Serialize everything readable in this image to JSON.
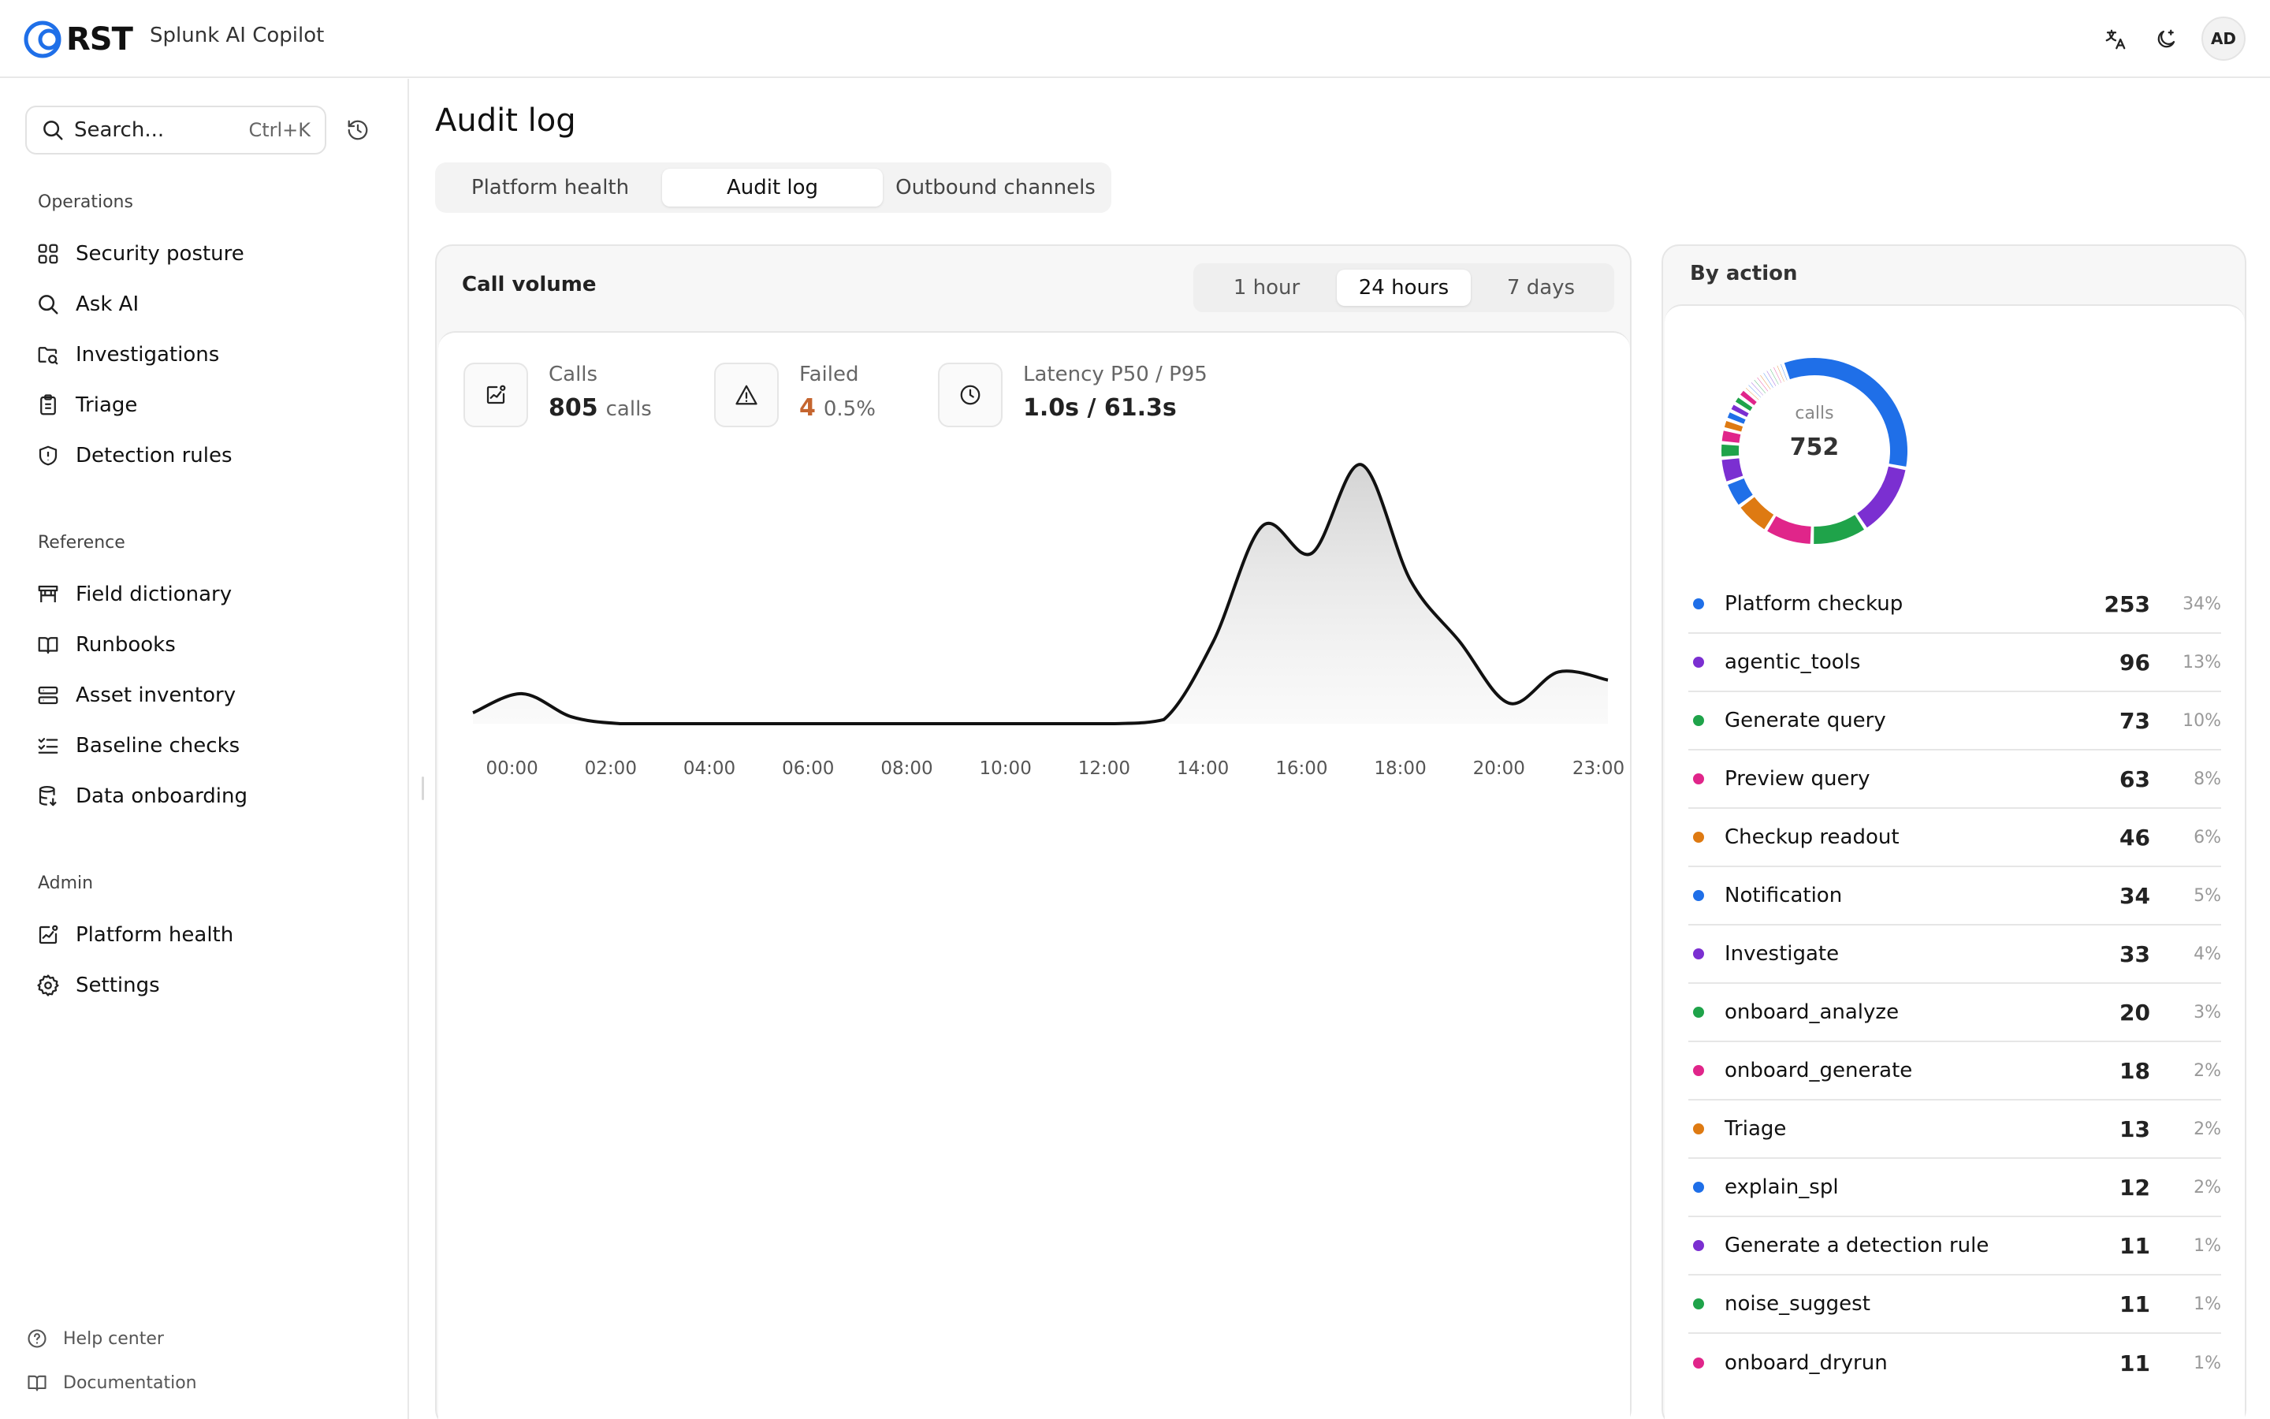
{
  "header": {
    "logo_text": "RST",
    "app_title": "Splunk AI Copilot",
    "avatar": "AD",
    "icons": [
      "translate-icon",
      "theme-moon-icon"
    ]
  },
  "sidebar": {
    "search_placeholder": "Search...",
    "search_shortcut": "Ctrl+K",
    "sections": [
      {
        "title": "Operations",
        "items": [
          {
            "label": "Security posture",
            "icon": "grid-icon"
          },
          {
            "label": "Ask AI",
            "icon": "search-icon"
          },
          {
            "label": "Investigations",
            "icon": "folder-search-icon"
          },
          {
            "label": "Triage",
            "icon": "clipboard-icon"
          },
          {
            "label": "Detection rules",
            "icon": "shield-icon"
          }
        ]
      },
      {
        "title": "Reference",
        "items": [
          {
            "label": "Field dictionary",
            "icon": "table-icon"
          },
          {
            "label": "Runbooks",
            "icon": "book-icon"
          },
          {
            "label": "Asset inventory",
            "icon": "server-icon"
          },
          {
            "label": "Baseline checks",
            "icon": "checklist-icon"
          },
          {
            "label": "Data onboarding",
            "icon": "database-icon"
          }
        ]
      },
      {
        "title": "Admin",
        "items": [
          {
            "label": "Platform health",
            "icon": "chart-box-icon"
          },
          {
            "label": "Settings",
            "icon": "gear-icon"
          }
        ]
      }
    ],
    "footer": [
      {
        "label": "Help center",
        "icon": "help-circle-icon"
      },
      {
        "label": "Documentation",
        "icon": "book-open-icon"
      }
    ]
  },
  "main": {
    "title": "Audit log",
    "tabs": [
      {
        "label": "Platform health",
        "active": false
      },
      {
        "label": "Audit log",
        "active": true
      },
      {
        "label": "Outbound channels",
        "active": false
      }
    ],
    "call_volume": {
      "title": "Call volume",
      "ranges": [
        {
          "label": "1 hour",
          "active": false
        },
        {
          "label": "24 hours",
          "active": true
        },
        {
          "label": "7 days",
          "active": false
        }
      ],
      "stats": {
        "calls_label": "Calls",
        "calls_value": "805",
        "calls_unit": "calls",
        "failed_label": "Failed",
        "failed_value": "4",
        "failed_pct": "0.5%",
        "latency_label": "Latency P50 / P95",
        "latency_value": "1.0s / 61.3s"
      }
    },
    "by_action": {
      "title": "By action",
      "donut_label": "calls",
      "donut_total": "752",
      "rows": [
        {
          "label": "Platform checkup",
          "count": "253",
          "pct": "34%",
          "color": "#1f6fe8"
        },
        {
          "label": "agentic_tools",
          "count": "96",
          "pct": "13%",
          "color": "#7b2fd1"
        },
        {
          "label": "Generate query",
          "count": "73",
          "pct": "10%",
          "color": "#1fa34a"
        },
        {
          "label": "Preview query",
          "count": "63",
          "pct": "8%",
          "color": "#e0258a"
        },
        {
          "label": "Checkup readout",
          "count": "46",
          "pct": "6%",
          "color": "#de7a12"
        },
        {
          "label": "Notification",
          "count": "34",
          "pct": "5%",
          "color": "#1f6fe8"
        },
        {
          "label": "Investigate",
          "count": "33",
          "pct": "4%",
          "color": "#7b2fd1"
        },
        {
          "label": "onboard_analyze",
          "count": "20",
          "pct": "3%",
          "color": "#1fa34a"
        },
        {
          "label": "onboard_generate",
          "count": "18",
          "pct": "2%",
          "color": "#e0258a"
        },
        {
          "label": "Triage",
          "count": "13",
          "pct": "2%",
          "color": "#de7a12"
        },
        {
          "label": "explain_spl",
          "count": "12",
          "pct": "2%",
          "color": "#1f6fe8"
        },
        {
          "label": "Generate a detection rule",
          "count": "11",
          "pct": "1%",
          "color": "#7b2fd1"
        },
        {
          "label": "noise_suggest",
          "count": "11",
          "pct": "1%",
          "color": "#1fa34a"
        },
        {
          "label": "onboard_dryrun",
          "count": "11",
          "pct": "1%",
          "color": "#e0258a"
        }
      ]
    }
  },
  "chart_data": [
    {
      "type": "area",
      "title": "Call volume",
      "x_tick_labels": [
        "00:00",
        "02:00",
        "04:00",
        "06:00",
        "08:00",
        "10:00",
        "12:00",
        "14:00",
        "16:00",
        "18:00",
        "20:00",
        "23:00"
      ],
      "x_hours": [
        0,
        1,
        2,
        3,
        4,
        5,
        6,
        7,
        8,
        9,
        10,
        11,
        12,
        13,
        14,
        15,
        16,
        17,
        18,
        19,
        20,
        21,
        22,
        23
      ],
      "series": [
        {
          "values": [
            8,
            22,
            5,
            0,
            0,
            0,
            0,
            0,
            0,
            0,
            0,
            0,
            0,
            0,
            3,
            60,
            145,
            125,
            190,
            105,
            60,
            15,
            38,
            32
          ]
        },
        {
          "values": [
            0,
            0,
            0,
            0,
            0,
            0,
            0,
            0,
            0,
            0,
            0,
            0,
            0,
            0,
            0,
            0,
            0,
            0,
            0,
            0,
            0,
            0,
            0,
            0
          ]
        }
      ],
      "ylim": [
        0,
        200
      ],
      "grid": false,
      "legend": "none"
    },
    {
      "type": "pie",
      "title": "By action",
      "total": 752,
      "categories": [
        "Platform checkup",
        "agentic_tools",
        "Generate query",
        "Preview query",
        "Checkup readout",
        "Notification",
        "Investigate",
        "onboard_analyze",
        "onboard_generate",
        "Triage",
        "explain_spl",
        "Generate a detection rule",
        "noise_suggest",
        "onboard_dryrun",
        "other-1",
        "other-2",
        "other-3",
        "other-4",
        "other-5",
        "other-6",
        "other-7",
        "other-8",
        "other-9",
        "other-10",
        "other-11",
        "other-12"
      ],
      "values": [
        253,
        96,
        73,
        63,
        46,
        34,
        33,
        20,
        18,
        13,
        12,
        11,
        11,
        11,
        5,
        5,
        5,
        5,
        5,
        5,
        5,
        5,
        5,
        5,
        5,
        5
      ],
      "colors": [
        "#1f6fe8",
        "#7b2fd1",
        "#1fa34a",
        "#e0258a",
        "#de7a12",
        "#1f6fe8",
        "#7b2fd1",
        "#1fa34a",
        "#e0258a",
        "#de7a12",
        "#1f6fe8",
        "#7b2fd1",
        "#1fa34a",
        "#e0258a",
        "#de7a12",
        "#1f6fe8",
        "#7b2fd1",
        "#1fa34a",
        "#e0258a",
        "#de7a12",
        "#1f6fe8",
        "#7b2fd1",
        "#1fa34a",
        "#e0258a",
        "#de7a12",
        "#1f6fe8"
      ]
    }
  ]
}
